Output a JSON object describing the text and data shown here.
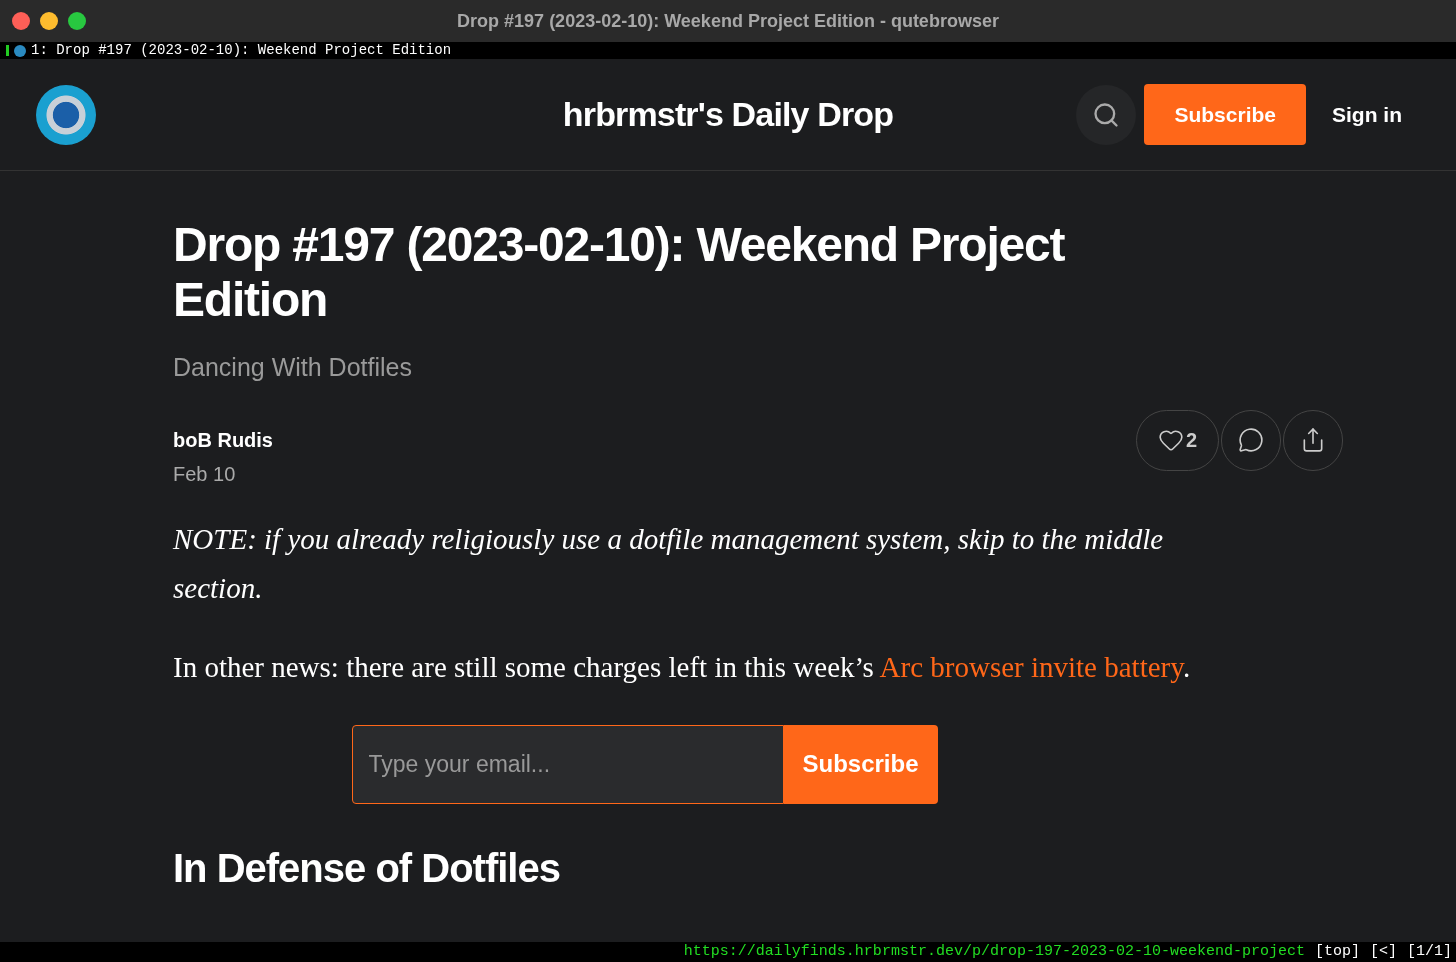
{
  "window": {
    "title": "Drop #197 (2023-02-10): Weekend Project Edition - qutebrowser"
  },
  "tab_bar": {
    "tabs": [
      {
        "label": "1: Drop #197 (2023-02-10): Weekend Project Edition",
        "selected": true
      }
    ]
  },
  "header": {
    "site_title": "hrbrmstr's Daily Drop",
    "subscribe": "Subscribe",
    "sign_in": "Sign in"
  },
  "post": {
    "title": "Drop #197 (2023-02-10): Weekend Project Edition",
    "subtitle": "Dancing With Dotfiles",
    "author": "boB Rudis",
    "date": "Feb 10",
    "likes": "2",
    "note": "NOTE: if you already religiously use a dotfile management system, skip to the middle section.",
    "news": {
      "before": "In other news: there are still some charges left in this week’s",
      "link": "Arc browser invite battery",
      "after": "."
    },
    "email": {
      "placeholder": "Type your email...",
      "button": "Subscribe"
    },
    "heading": "In Defense of Dotfiles"
  },
  "status_bar": {
    "url": "https://dailyfinds.hrbrmstr.dev/p/drop-197-2023-02-10-weekend-project",
    "position": "[top]",
    "history": "[<]",
    "tabs": "[1/1]"
  }
}
